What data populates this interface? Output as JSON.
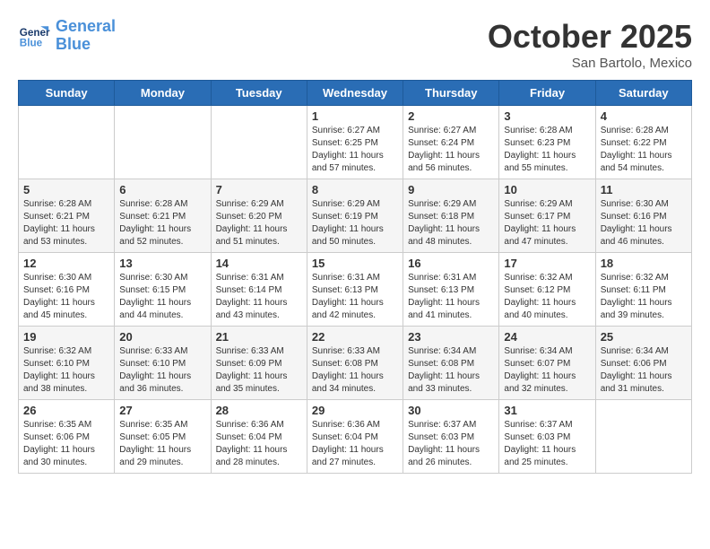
{
  "header": {
    "logo_line1": "General",
    "logo_line2": "Blue",
    "month": "October 2025",
    "location": "San Bartolo, Mexico"
  },
  "days_of_week": [
    "Sunday",
    "Monday",
    "Tuesday",
    "Wednesday",
    "Thursday",
    "Friday",
    "Saturday"
  ],
  "weeks": [
    [
      {
        "day": "",
        "info": ""
      },
      {
        "day": "",
        "info": ""
      },
      {
        "day": "",
        "info": ""
      },
      {
        "day": "1",
        "info": "Sunrise: 6:27 AM\nSunset: 6:25 PM\nDaylight: 11 hours\nand 57 minutes."
      },
      {
        "day": "2",
        "info": "Sunrise: 6:27 AM\nSunset: 6:24 PM\nDaylight: 11 hours\nand 56 minutes."
      },
      {
        "day": "3",
        "info": "Sunrise: 6:28 AM\nSunset: 6:23 PM\nDaylight: 11 hours\nand 55 minutes."
      },
      {
        "day": "4",
        "info": "Sunrise: 6:28 AM\nSunset: 6:22 PM\nDaylight: 11 hours\nand 54 minutes."
      }
    ],
    [
      {
        "day": "5",
        "info": "Sunrise: 6:28 AM\nSunset: 6:21 PM\nDaylight: 11 hours\nand 53 minutes."
      },
      {
        "day": "6",
        "info": "Sunrise: 6:28 AM\nSunset: 6:21 PM\nDaylight: 11 hours\nand 52 minutes."
      },
      {
        "day": "7",
        "info": "Sunrise: 6:29 AM\nSunset: 6:20 PM\nDaylight: 11 hours\nand 51 minutes."
      },
      {
        "day": "8",
        "info": "Sunrise: 6:29 AM\nSunset: 6:19 PM\nDaylight: 11 hours\nand 50 minutes."
      },
      {
        "day": "9",
        "info": "Sunrise: 6:29 AM\nSunset: 6:18 PM\nDaylight: 11 hours\nand 48 minutes."
      },
      {
        "day": "10",
        "info": "Sunrise: 6:29 AM\nSunset: 6:17 PM\nDaylight: 11 hours\nand 47 minutes."
      },
      {
        "day": "11",
        "info": "Sunrise: 6:30 AM\nSunset: 6:16 PM\nDaylight: 11 hours\nand 46 minutes."
      }
    ],
    [
      {
        "day": "12",
        "info": "Sunrise: 6:30 AM\nSunset: 6:16 PM\nDaylight: 11 hours\nand 45 minutes."
      },
      {
        "day": "13",
        "info": "Sunrise: 6:30 AM\nSunset: 6:15 PM\nDaylight: 11 hours\nand 44 minutes."
      },
      {
        "day": "14",
        "info": "Sunrise: 6:31 AM\nSunset: 6:14 PM\nDaylight: 11 hours\nand 43 minutes."
      },
      {
        "day": "15",
        "info": "Sunrise: 6:31 AM\nSunset: 6:13 PM\nDaylight: 11 hours\nand 42 minutes."
      },
      {
        "day": "16",
        "info": "Sunrise: 6:31 AM\nSunset: 6:13 PM\nDaylight: 11 hours\nand 41 minutes."
      },
      {
        "day": "17",
        "info": "Sunrise: 6:32 AM\nSunset: 6:12 PM\nDaylight: 11 hours\nand 40 minutes."
      },
      {
        "day": "18",
        "info": "Sunrise: 6:32 AM\nSunset: 6:11 PM\nDaylight: 11 hours\nand 39 minutes."
      }
    ],
    [
      {
        "day": "19",
        "info": "Sunrise: 6:32 AM\nSunset: 6:10 PM\nDaylight: 11 hours\nand 38 minutes."
      },
      {
        "day": "20",
        "info": "Sunrise: 6:33 AM\nSunset: 6:10 PM\nDaylight: 11 hours\nand 36 minutes."
      },
      {
        "day": "21",
        "info": "Sunrise: 6:33 AM\nSunset: 6:09 PM\nDaylight: 11 hours\nand 35 minutes."
      },
      {
        "day": "22",
        "info": "Sunrise: 6:33 AM\nSunset: 6:08 PM\nDaylight: 11 hours\nand 34 minutes."
      },
      {
        "day": "23",
        "info": "Sunrise: 6:34 AM\nSunset: 6:08 PM\nDaylight: 11 hours\nand 33 minutes."
      },
      {
        "day": "24",
        "info": "Sunrise: 6:34 AM\nSunset: 6:07 PM\nDaylight: 11 hours\nand 32 minutes."
      },
      {
        "day": "25",
        "info": "Sunrise: 6:34 AM\nSunset: 6:06 PM\nDaylight: 11 hours\nand 31 minutes."
      }
    ],
    [
      {
        "day": "26",
        "info": "Sunrise: 6:35 AM\nSunset: 6:06 PM\nDaylight: 11 hours\nand 30 minutes."
      },
      {
        "day": "27",
        "info": "Sunrise: 6:35 AM\nSunset: 6:05 PM\nDaylight: 11 hours\nand 29 minutes."
      },
      {
        "day": "28",
        "info": "Sunrise: 6:36 AM\nSunset: 6:04 PM\nDaylight: 11 hours\nand 28 minutes."
      },
      {
        "day": "29",
        "info": "Sunrise: 6:36 AM\nSunset: 6:04 PM\nDaylight: 11 hours\nand 27 minutes."
      },
      {
        "day": "30",
        "info": "Sunrise: 6:37 AM\nSunset: 6:03 PM\nDaylight: 11 hours\nand 26 minutes."
      },
      {
        "day": "31",
        "info": "Sunrise: 6:37 AM\nSunset: 6:03 PM\nDaylight: 11 hours\nand 25 minutes."
      },
      {
        "day": "",
        "info": ""
      }
    ]
  ]
}
